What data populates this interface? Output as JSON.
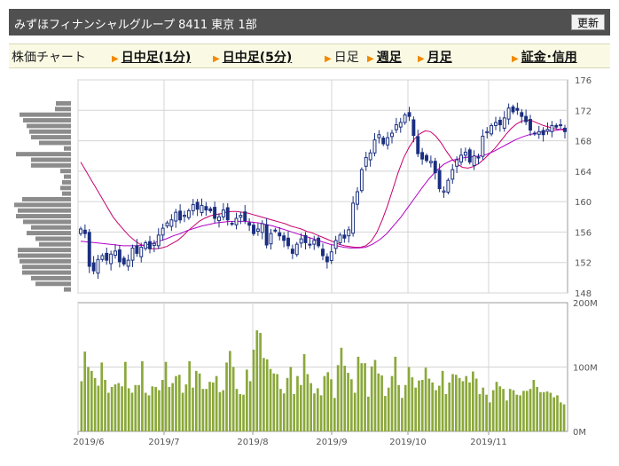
{
  "header": {
    "title": "みずほフィナンシャルグループ 8411 東京 1部",
    "refresh_label": "更新"
  },
  "tabs": [
    {
      "label": "株価チャート",
      "link": false,
      "arrow": false
    },
    {
      "label": "日中足(1分)",
      "link": true,
      "arrow": true
    },
    {
      "label": "日中足(5分)",
      "link": true,
      "arrow": true
    },
    {
      "label": "日足",
      "link": false,
      "arrow": true
    },
    {
      "label": "週足",
      "link": true,
      "arrow": true
    },
    {
      "label": "月足",
      "link": true,
      "arrow": true
    },
    {
      "label": "証金･信用",
      "link": true,
      "arrow": true
    }
  ],
  "colors": {
    "candle": "#1a2f80",
    "ma_short": "#c8006e",
    "ma_long": "#b400c8",
    "volume": "#8aa83a",
    "profile": "#8c8c8c",
    "grid": "#d4d4d4",
    "frame": "#9a9a9a"
  },
  "chart_data": [
    {
      "type": "candlestick",
      "title": "",
      "x_tick_labels": [
        "2019/6",
        "2019/7",
        "2019/8",
        "2019/9",
        "2019/10",
        "2019/11"
      ],
      "y_tick_labels": [
        "176",
        "172",
        "168",
        "164",
        "160",
        "156",
        "152",
        "148"
      ],
      "ylim": [
        148,
        176
      ],
      "grid": true,
      "close": [
        156.4,
        155.8,
        151.5,
        150.9,
        152.4,
        152.9,
        152.3,
        153.1,
        153.5,
        152.1,
        151.8,
        152.3,
        153.9,
        153.2,
        154.0,
        154.6,
        153.8,
        154.5,
        155.6,
        156.5,
        157.2,
        157.6,
        158.6,
        157.6,
        158.2,
        158.8,
        159.6,
        159.0,
        159.5,
        158.9,
        158.8,
        157.8,
        158.0,
        158.9,
        157.6,
        157.1,
        157.8,
        158.2,
        157.5,
        156.9,
        155.8,
        156.4,
        157.1,
        154.3,
        155.8,
        156.2,
        155.5,
        154.9,
        154.2,
        153.2,
        154.4,
        155.1,
        154.6,
        154.4,
        154.9,
        154.2,
        152.9,
        152.1,
        153.4,
        154.9,
        155.6,
        155.2,
        156.3,
        159.8,
        161.3,
        164.2,
        165.8,
        166.4,
        168.1,
        168.8,
        167.6,
        168.4,
        169.0,
        170.1,
        170.4,
        171.4,
        171.2,
        168.7,
        166.3,
        165.6,
        165.4,
        165.3,
        163.8,
        161.7,
        161.4,
        162.8,
        164.2,
        165.5,
        166.1,
        166.5,
        165.2,
        166.0,
        165.8,
        168.6,
        169.2,
        170.0,
        170.4,
        170.1,
        171.0,
        172.3,
        171.8,
        172.0,
        171.2,
        170.5,
        169.4,
        169.0,
        169.2,
        168.8,
        169.5,
        170.0,
        169.8,
        170.1,
        169.2
      ],
      "series": [
        {
          "name": "",
          "values": [
            165.2,
            164.0,
            162.8,
            161.6,
            160.4,
            159.2,
            158.0,
            157.1,
            156.3,
            155.5,
            154.9,
            154.4,
            154.1,
            153.8,
            153.8,
            153.9,
            154.1,
            154.5,
            154.9,
            155.5,
            156.2,
            156.8,
            157.4,
            157.8,
            158.1,
            158.3,
            158.4,
            158.6,
            158.7,
            158.7,
            158.6,
            158.5,
            158.3,
            158.1,
            157.9,
            157.7,
            157.5,
            157.3,
            157.1,
            156.8,
            156.6,
            156.4,
            156.1,
            155.9,
            155.6,
            155.3,
            155.0,
            154.7,
            154.4,
            154.2,
            154.1,
            154.0,
            154.0,
            154.2,
            154.8,
            155.9,
            157.5,
            159.4,
            161.6,
            163.8,
            165.7,
            167.1,
            168.2,
            168.9,
            169.3,
            169.2,
            168.6,
            167.7,
            166.6,
            165.6,
            164.9,
            164.5,
            164.4,
            164.6,
            165.0,
            165.6,
            166.3,
            167.0,
            167.9,
            168.8,
            169.6,
            170.2,
            170.6,
            170.7,
            170.6,
            170.3,
            170.0,
            169.8,
            169.6,
            169.5,
            169.4
          ]
        },
        {
          "name": "",
          "values": [
            154.8,
            154.7,
            154.6,
            154.5,
            154.4,
            154.3,
            154.2,
            154.2,
            154.2,
            154.3,
            154.5,
            154.8,
            155.1,
            155.5,
            155.8,
            156.2,
            156.5,
            156.8,
            157.0,
            157.2,
            157.3,
            157.4,
            157.4,
            157.4,
            157.3,
            157.2,
            157.0,
            156.8,
            156.5,
            156.2,
            155.9,
            155.6,
            155.3,
            155.0,
            154.7,
            154.4,
            154.2,
            154.0,
            153.9,
            153.9,
            154.0,
            154.4,
            155.0,
            155.8,
            156.9,
            158.0,
            159.3,
            160.6,
            161.9,
            163.1,
            164.1,
            164.9,
            165.4,
            165.6,
            165.8,
            165.9,
            166.0,
            166.2,
            166.6,
            167.1,
            167.6,
            168.1,
            168.5,
            168.8,
            169.0,
            169.2,
            169.3,
            169.4,
            169.6
          ]
        }
      ]
    },
    {
      "type": "bar",
      "title": "",
      "x_tick_labels": [
        "2019/6",
        "2019/7",
        "2019/8",
        "2019/9",
        "2019/10",
        "2019/11"
      ],
      "y_tick_labels": [
        "200M",
        "100M",
        "0M"
      ],
      "ylim": [
        0,
        200
      ],
      "values": [
        78,
        124,
        100,
        94,
        83,
        71,
        107,
        80,
        60,
        69,
        73,
        75,
        70,
        108,
        67,
        60,
        72,
        72,
        109,
        60,
        56,
        70,
        69,
        64,
        80,
        108,
        69,
        75,
        86,
        88,
        60,
        73,
        109,
        68,
        94,
        90,
        66,
        66,
        77,
        76,
        86,
        61,
        64,
        107,
        125,
        100,
        66,
        58,
        57,
        96,
        78,
        127,
        157,
        153,
        114,
        112,
        97,
        90,
        89,
        66,
        59,
        83,
        100,
        58,
        86,
        72,
        120,
        89,
        75,
        59,
        67,
        56,
        86,
        92,
        81,
        52,
        103,
        130,
        102,
        91,
        81,
        60,
        116,
        106,
        106,
        54,
        101,
        111,
        90,
        87,
        55,
        68,
        86,
        116,
        72,
        52,
        72,
        100,
        84,
        68,
        79,
        80,
        99,
        82,
        76,
        64,
        71,
        94,
        58,
        76,
        89,
        88,
        83,
        78,
        86,
        76
      ],
      "series": [
        {
          "name": "",
          "values": [
            93,
            82,
            58,
            68,
            57,
            45,
            64,
            77,
            70,
            66,
            48,
            66,
            64,
            57,
            56,
            63,
            63,
            66,
            80,
            69,
            61,
            61,
            62,
            60,
            53,
            56,
            45,
            42
          ]
        }
      ]
    },
    {
      "type": "bar",
      "title": "",
      "categories": [],
      "values": [
        17,
        18,
        58,
        54,
        50,
        47,
        45,
        36,
        8,
        62,
        45,
        45,
        12,
        8,
        10,
        12,
        10,
        55,
        64,
        60,
        62,
        54,
        45,
        50,
        40,
        36,
        60,
        60,
        58,
        55,
        55,
        45,
        40,
        8
      ]
    }
  ]
}
